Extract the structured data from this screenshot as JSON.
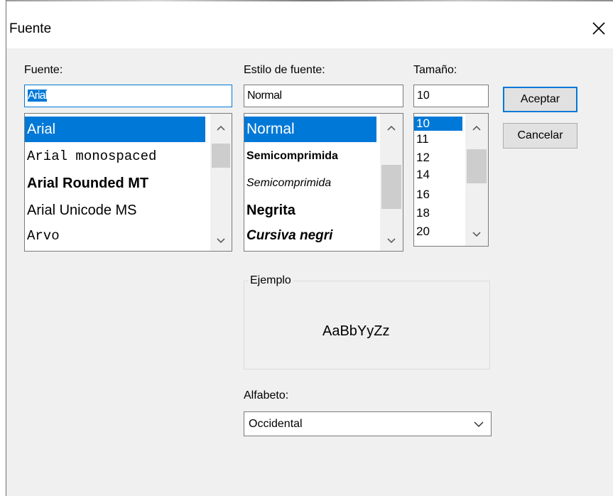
{
  "dialog": {
    "title": "Fuente",
    "close_icon": "close-icon"
  },
  "font": {
    "label": "Fuente:",
    "value": "Arial",
    "items": [
      "Arial",
      "Arial monospaced",
      "Arial Rounded MT",
      "Arial Unicode MS",
      "Arvo"
    ],
    "selected_index": 0
  },
  "style": {
    "label": "Estilo de fuente:",
    "value": "Normal",
    "items": [
      "Normal",
      "Semicomprimida",
      "Semicomprimida",
      "Negrita",
      "Cursiva negri"
    ],
    "selected_index": 0
  },
  "size": {
    "label": "Tamaño:",
    "value": "10",
    "items": [
      "10",
      "11",
      "12",
      "14",
      "16",
      "18",
      "20"
    ],
    "selected_index": 0
  },
  "buttons": {
    "ok": "Aceptar",
    "cancel": "Cancelar"
  },
  "sample": {
    "group_label": "Ejemplo",
    "text": "AaBbYyZz"
  },
  "script": {
    "label": "Alfabeto:",
    "value": "Occidental"
  },
  "colors": {
    "accent": "#0078d7",
    "dialog_bg": "#f0f0f0"
  }
}
